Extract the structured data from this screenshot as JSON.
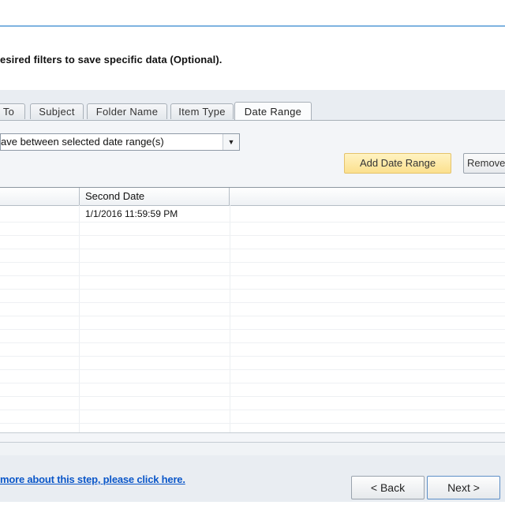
{
  "instruction": "esired filters to save specific data (Optional).",
  "tabs": [
    {
      "label": "To"
    },
    {
      "label": "Subject"
    },
    {
      "label": "Folder Name"
    },
    {
      "label": "Item Type"
    },
    {
      "label": "Date Range",
      "active": true
    }
  ],
  "filter_select": {
    "value": "ave between selected date range(s)",
    "arrow": "▼"
  },
  "buttons": {
    "add_date_range": "Add Date Range",
    "remove": "Remove"
  },
  "grid": {
    "columns": [
      "",
      "Second Date",
      ""
    ],
    "rows": [
      [
        "",
        "1/1/2016 11:59:59 PM",
        ""
      ]
    ]
  },
  "footer": {
    "help_link": "more about this step, please click here.",
    "back": "< Back",
    "next": "Next >"
  },
  "colors": {
    "accent_button": "#fbe08e",
    "link": "#0b57c9",
    "title_border": "#7fb3e0"
  }
}
